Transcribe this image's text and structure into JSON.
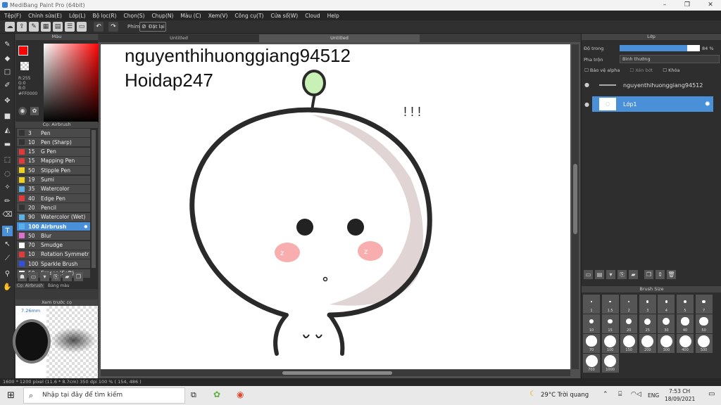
{
  "window": {
    "title": "MediBang Paint Pro (64bit)"
  },
  "menu": [
    "Tệp(F)",
    "Chỉnh sửa(E)",
    "Lớp(L)",
    "Bộ lọc(R)",
    "Chọn(S)",
    "Chụp(N)",
    "Màu (C)",
    "Xem(V)",
    "Công cụ(T)",
    "Cửa sổ(W)",
    "Cloud",
    "Help"
  ],
  "toolbar": {
    "hand_label": "Phím",
    "reset_label": "Đặt lại"
  },
  "color_panel": {
    "title": "Màu",
    "r": "R:255",
    "g": "G:0",
    "b": "B:0",
    "hex": "#FF0000",
    "fg": "#ff0000"
  },
  "brush_panel": {
    "title": "Cọ: Airbrush",
    "tab1": "Cọ: Airbrush",
    "tab2": "Bảng màu",
    "items": [
      {
        "size": "3",
        "name": "Pen",
        "color": "#333333"
      },
      {
        "size": "10",
        "name": "Pen (Sharp)",
        "color": "#333333"
      },
      {
        "size": "15",
        "name": "G Pen",
        "color": "#e23a3a"
      },
      {
        "size": "15",
        "name": "Mapping Pen",
        "color": "#e23a3a"
      },
      {
        "size": "50",
        "name": "Stipple Pen",
        "color": "#f0d020"
      },
      {
        "size": "19",
        "name": "Sumi",
        "color": "#f0d020"
      },
      {
        "size": "35",
        "name": "Watercolor",
        "color": "#5ab0e8"
      },
      {
        "size": "40",
        "name": "Edge Pen",
        "color": "#e23a3a"
      },
      {
        "size": "20",
        "name": "Pencil",
        "color": "#333333"
      },
      {
        "size": "90",
        "name": "Watercolor (Wet)",
        "color": "#5ab0e8"
      },
      {
        "size": "100",
        "name": "Airbrush",
        "color": "#5ab0e8"
      },
      {
        "size": "50",
        "name": "Blur",
        "color": "#e070d0"
      },
      {
        "size": "70",
        "name": "Smudge",
        "color": "#ffffff"
      },
      {
        "size": "10",
        "name": "Rotation Symmetr",
        "color": "#e23a3a"
      },
      {
        "size": "100",
        "name": "Sparkle Brush",
        "color": "#3050e0"
      },
      {
        "size": "50",
        "name": "Eraser (Soft)",
        "color": "#ffffff"
      }
    ]
  },
  "preview": {
    "title": "Xem trước cọ",
    "size": "7.26mm"
  },
  "canvas": {
    "tab1": "Untitled",
    "tab2": "Untitled",
    "text1": "nguyenthihuonggiang94512",
    "text2": "Hoidap247",
    "exclaim": "! ! !"
  },
  "layer_panel": {
    "title": "Lớp",
    "opacity_label": "Độ trong",
    "opacity_value": "84 %",
    "opacity": 0.84,
    "blend_label": "Pha trộn",
    "blend_value": "Bình thường",
    "protect_alpha": "Bảo vệ alpha",
    "clipping": "Xén bớt",
    "lock": "Khóa",
    "layers": [
      {
        "name": "nguyenthihuonggiang94512"
      },
      {
        "name": "Lớp1"
      }
    ]
  },
  "brush_size": {
    "title": "Brush Size",
    "sizes": [
      "1",
      "1.5",
      "2",
      "3",
      "4",
      "5",
      "7",
      "10",
      "15",
      "20",
      "25",
      "30",
      "40",
      "50",
      "70",
      "100",
      "150",
      "200",
      "300",
      "400",
      "500",
      "700",
      "1000"
    ]
  },
  "status": {
    "text": "1600 * 1200 pixel   (11.6 * 8.7cm)   350 dpi   100 %   ( 154, 486 )"
  },
  "taskbar": {
    "search": "Nhập tại đây để tìm kiếm",
    "weather": "29°C  Trời quang",
    "lang": "ENG",
    "time": "7:53 CH",
    "date": "18/09/2021"
  }
}
